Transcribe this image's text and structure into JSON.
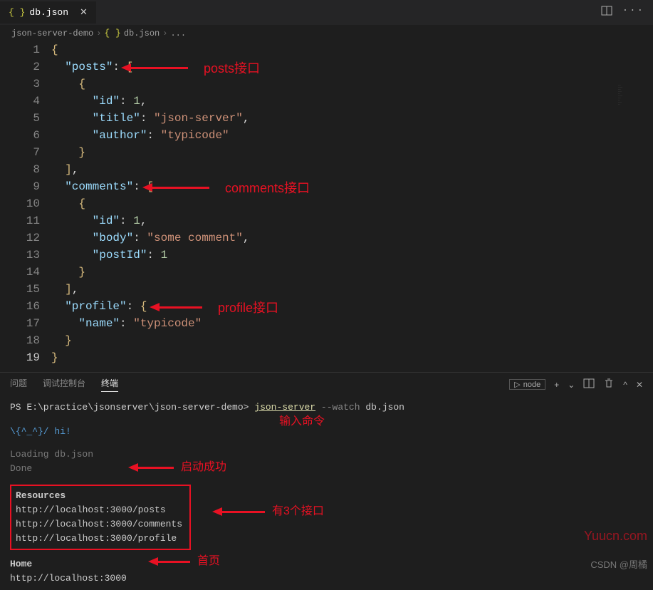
{
  "tab": {
    "icon": "{ }",
    "name": "db.json",
    "close": "✕"
  },
  "titleBarIcons": {
    "split": "split-editor-icon",
    "more": "more-icon"
  },
  "breadcrumb": {
    "root": "json-server-demo",
    "file": "db.json",
    "icon": "{ }",
    "rest": "..."
  },
  "code": {
    "lines": [
      1,
      2,
      3,
      4,
      5,
      6,
      7,
      8,
      9,
      10,
      11,
      12,
      13,
      14,
      15,
      16,
      17,
      18,
      19
    ],
    "active": 19,
    "json": {
      "posts": [
        {
          "id": 1,
          "title": "json-server",
          "author": "typicode"
        }
      ],
      "comments": [
        {
          "id": 1,
          "body": "some comment",
          "postId": 1
        }
      ],
      "profile": {
        "name": "typicode"
      }
    }
  },
  "annotations": {
    "posts": "posts接口",
    "comments": "comments接口",
    "profile": "profile接口",
    "cmd": "输入命令",
    "start": "启动成功",
    "apis": "有3个接口",
    "home": "首页"
  },
  "panel": {
    "tabs": {
      "problems": "问题",
      "debug": "调试控制台",
      "terminal": "终端"
    },
    "right": {
      "node": "node",
      "plus": "+",
      "split": "split",
      "trash": "trash",
      "up": "^",
      "close": "✕"
    }
  },
  "terminal": {
    "prompt": "PS E:\\practice\\jsonserver\\json-server-demo>",
    "cmd": "json-server",
    "flag": "--watch",
    "arg": "db.json",
    "hi": "\\{^_^}/ hi!",
    "loading": "Loading db.json",
    "done": "Done",
    "resourcesHeader": "Resources",
    "urls": [
      "http://localhost:3000/posts",
      "http://localhost:3000/comments",
      "http://localhost:3000/profile"
    ],
    "homeHeader": "Home",
    "homeUrl": "http://localhost:3000"
  },
  "watermarks": {
    "site": "Yuucn.com",
    "author": "CSDN @周橘"
  }
}
